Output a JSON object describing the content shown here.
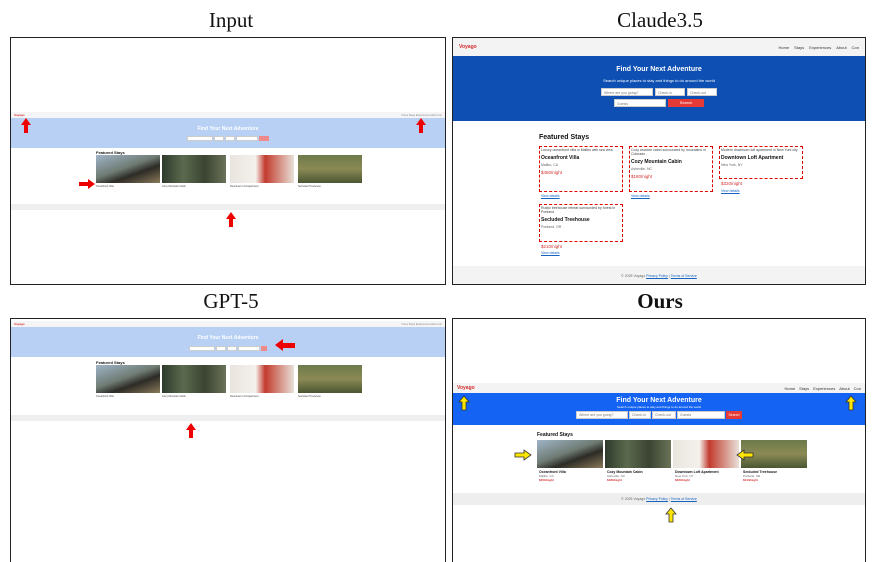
{
  "titles": {
    "input": "Input",
    "claude": "Claude3.5",
    "gpt": "GPT-5",
    "ours": "Ours"
  },
  "site": {
    "brand": "Voyago",
    "nav": [
      "Home",
      "Stays",
      "Experiences",
      "About",
      "Con"
    ],
    "hero_title": "Find Your Next Adventure",
    "hero_subtitle": "Search unique places to stay and things to do around the world",
    "search": {
      "where_placeholder": "Where are you going?",
      "checkin": "Check-in",
      "checkout": "Check-out",
      "guests": "Guests",
      "button": "Search"
    },
    "featured_title": "Featured Stays",
    "cards": [
      {
        "name": "Oceanfront Villa",
        "location": "Malibu, CA",
        "price": "$450/night",
        "alt": "Luxury oceanfront villa in Malibu with sea view"
      },
      {
        "name": "Cozy Mountain Cabin",
        "location": "Asheville, NC",
        "price": "$180/night",
        "alt": "Cozy wooden cabin surrounded by mountains in Colorado"
      },
      {
        "name": "Downtown Loft Apartment",
        "location": "New York, NY",
        "price": "$320/night",
        "alt": "Modern downtown loft apartment in New York city"
      },
      {
        "name": "Secluded Treehouse",
        "location": "Portland, OR",
        "price": "$210/night",
        "alt": "Rustic treehouse retreat surrounded by forest in Portland"
      }
    ],
    "view_details": "View details",
    "footer": {
      "copyright": "© 2025 Voyago",
      "privacy": "Privacy Policy",
      "sep": "|",
      "terms": "Terms of Service"
    }
  }
}
